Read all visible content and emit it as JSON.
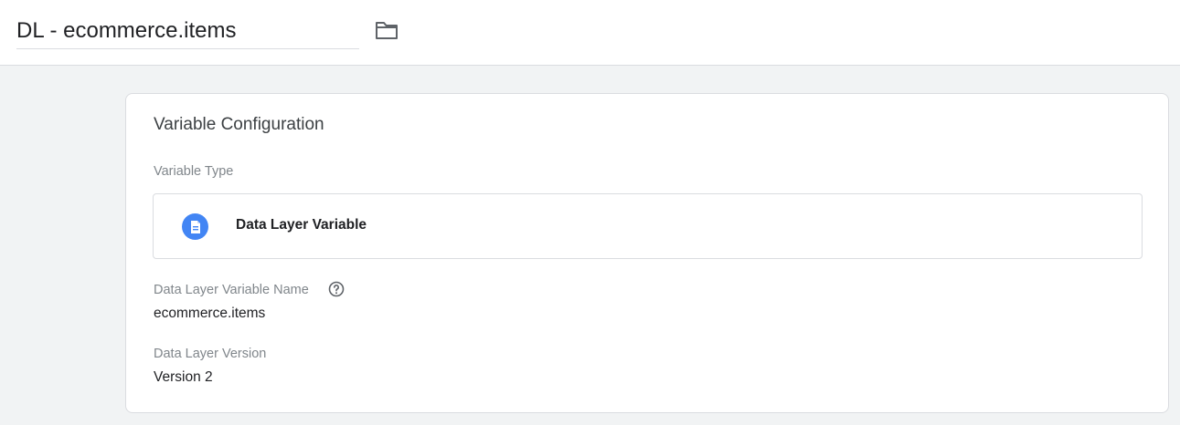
{
  "header": {
    "variable_name": "DL - ecommerce.items",
    "folder_icon": "folder-icon"
  },
  "config": {
    "title": "Variable Configuration",
    "variable_type_label": "Variable Type",
    "variable_type": {
      "name": "Data Layer Variable",
      "icon": "document-icon",
      "icon_color": "#4285f4"
    },
    "dl_name_label": "Data Layer Variable Name",
    "dl_name_help_icon": "help-icon",
    "dl_name_value": "ecommerce.items",
    "dl_version_label": "Data Layer Version",
    "dl_version_value": "Version 2"
  },
  "colors": {
    "background": "#f1f3f4",
    "card": "#ffffff",
    "border": "#dadce0",
    "label": "#80868b",
    "accent": "#4285f4"
  }
}
